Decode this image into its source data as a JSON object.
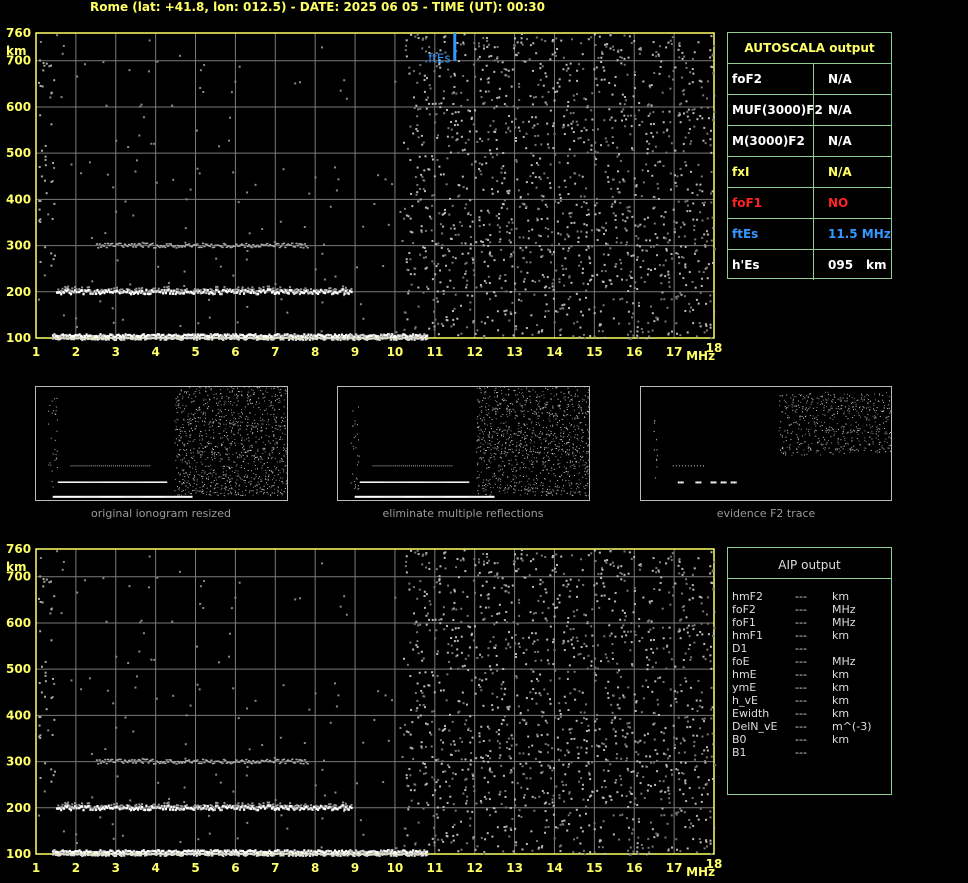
{
  "header": {
    "title": "Rome (lat: +41.8, lon: 012.5) - DATE: 2025 06 05 - TIME (UT): 00:30"
  },
  "colors": {
    "axis": "#ffff66",
    "grid": "#7a7a7a",
    "panel_border": "#8fcc8f",
    "ftes_marker": "#3399ff",
    "label_yellow": "#ffff66",
    "label_red": "#ff2222",
    "label_blue": "#3399ff"
  },
  "chart_data": [
    {
      "type": "scatter",
      "id": "ionogram-main",
      "y_unit": "km",
      "x_unit": "MHz",
      "xlim": [
        1,
        18
      ],
      "ylim": [
        100,
        760
      ],
      "x_ticks": [
        "1",
        "2",
        "3",
        "4",
        "5",
        "6",
        "7",
        "8",
        "9",
        "10",
        "11",
        "12",
        "13",
        "14",
        "15",
        "16",
        "17",
        "18"
      ],
      "y_ticks": [
        "100",
        "200",
        "300",
        "400",
        "500",
        "600",
        "700",
        "760"
      ],
      "grid": true,
      "traces": [
        {
          "x_range": [
            1.4,
            10.8
          ],
          "y": 105
        },
        {
          "x_range": [
            1.5,
            8.9
          ],
          "y": 200
        },
        {
          "x_range": [
            2.5,
            7.8
          ],
          "y": 300
        }
      ],
      "annotation": {
        "label": "ftEs",
        "x": 11.5
      }
    },
    {
      "type": "scatter",
      "id": "ionogram-aip",
      "y_unit": "km",
      "x_unit": "MHz",
      "xlim": [
        1,
        18
      ],
      "ylim": [
        100,
        760
      ],
      "x_ticks": [
        "1",
        "2",
        "3",
        "4",
        "5",
        "6",
        "7",
        "8",
        "9",
        "10",
        "11",
        "12",
        "13",
        "14",
        "15",
        "16",
        "17",
        "18"
      ],
      "y_ticks": [
        "100",
        "200",
        "300",
        "400",
        "500",
        "600",
        "700",
        "760"
      ],
      "grid": true,
      "traces": [
        {
          "x_range": [
            1.4,
            10.8
          ],
          "y": 105
        },
        {
          "x_range": [
            1.5,
            8.9
          ],
          "y": 200
        },
        {
          "x_range": [
            2.5,
            7.8
          ],
          "y": 300
        }
      ]
    }
  ],
  "autoscala": {
    "title": "AUTOSCALA output",
    "rows": [
      {
        "label": "foF2",
        "value": "N/A",
        "unit": "",
        "color": "#ffffff"
      },
      {
        "label": "MUF(3000)F2",
        "value": "N/A",
        "unit": "",
        "color": "#ffffff"
      },
      {
        "label": "M(3000)F2",
        "value": "N/A",
        "unit": "",
        "color": "#ffffff"
      },
      {
        "label": "fxI",
        "value": "N/A",
        "unit": "",
        "color": "#ffff66"
      },
      {
        "label": "foF1",
        "value": "NO",
        "unit": "",
        "color": "#ff2222"
      },
      {
        "label": "ftEs",
        "value": "11.5 MHz",
        "unit": "",
        "color": "#3399ff"
      },
      {
        "label": "h'Es",
        "value": "095",
        "unit": "km",
        "color": "#ffffff"
      }
    ]
  },
  "thumbnails": [
    {
      "caption": "original ionogram resized"
    },
    {
      "caption": "eliminate multiple reflections"
    },
    {
      "caption": "evidence F2 trace"
    }
  ],
  "aip": {
    "title": "AIP output",
    "rows": [
      {
        "param": "hmF2",
        "value": "---",
        "unit": "km"
      },
      {
        "param": "foF2",
        "value": "---",
        "unit": "MHz"
      },
      {
        "param": "foF1",
        "value": "---",
        "unit": "MHz"
      },
      {
        "param": "hmF1",
        "value": "---",
        "unit": "km"
      },
      {
        "param": "D1",
        "value": "---",
        "unit": ""
      },
      {
        "param": "foE",
        "value": "---",
        "unit": "MHz"
      },
      {
        "param": "hmE",
        "value": "---",
        "unit": "km"
      },
      {
        "param": "ymE",
        "value": "---",
        "unit": "km"
      },
      {
        "param": "h_vE",
        "value": "---",
        "unit": "km"
      },
      {
        "param": "Ewidth",
        "value": "---",
        "unit": "km"
      },
      {
        "param": "DelN_vE",
        "value": "---",
        "unit": "m^(-3)"
      },
      {
        "param": "B0",
        "value": "---",
        "unit": "km"
      },
      {
        "param": "B1",
        "value": "---",
        "unit": ""
      }
    ]
  }
}
